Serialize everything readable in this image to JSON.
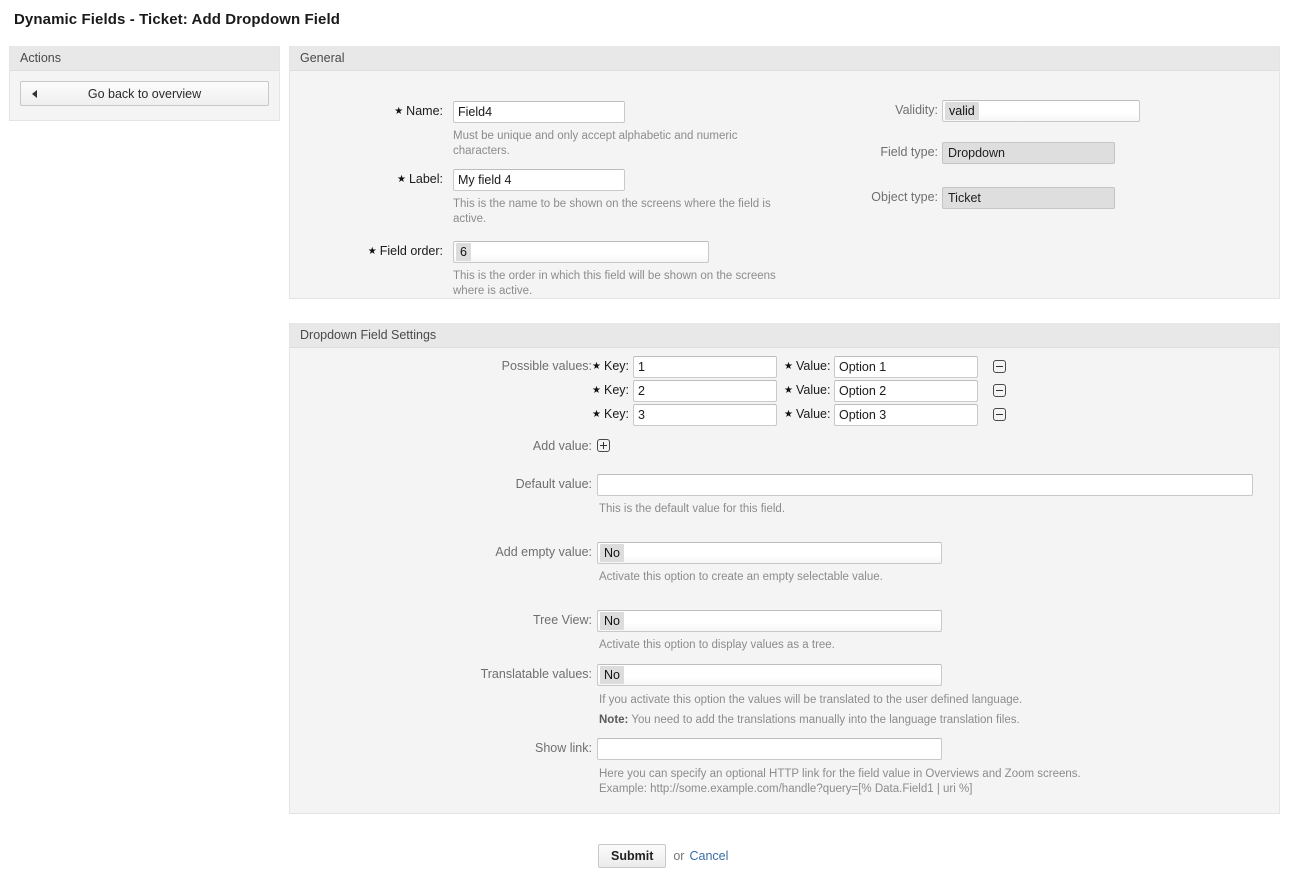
{
  "page": {
    "title": "Dynamic Fields - Ticket: Add Dropdown Field"
  },
  "sidebar": {
    "header": "Actions",
    "back_button": {
      "label": "Go back to overview",
      "icon": "left-arrow-icon"
    }
  },
  "general": {
    "header": "General",
    "name": {
      "label": "Name:",
      "required": true,
      "value": "Field4",
      "hint": "Must be unique and only accept alphabetic and numeric characters."
    },
    "label_field": {
      "label": "Label:",
      "required": true,
      "value": "My field 4",
      "hint": "This is the name to be shown on the screens where the field is active."
    },
    "field_order": {
      "label": "Field order:",
      "required": true,
      "value": "6",
      "hint": "This is the order in which this field will be shown on the screens where is active."
    },
    "validity": {
      "label": "Validity:",
      "value": "valid"
    },
    "field_type": {
      "label": "Field type:",
      "value": "Dropdown"
    },
    "object_type": {
      "label": "Object type:",
      "value": "Ticket"
    }
  },
  "dropdown_settings": {
    "header": "Dropdown Field Settings",
    "possible_values": {
      "label": "Possible values:",
      "key_label": "Key:",
      "value_label": "Value:",
      "remove_icon": "remove-value-icon",
      "rows": [
        {
          "key": "1",
          "value": "Option 1"
        },
        {
          "key": "2",
          "value": "Option 2"
        },
        {
          "key": "3",
          "value": "Option 3"
        }
      ]
    },
    "add_value": {
      "label": "Add value:",
      "icon": "add-value-icon"
    },
    "default_value": {
      "label": "Default value:",
      "value": "",
      "hint": "This is the default value for this field."
    },
    "add_empty_value": {
      "label": "Add empty value:",
      "value": "No",
      "hint": "Activate this option to create an empty selectable value."
    },
    "tree_view": {
      "label": "Tree View:",
      "value": "No",
      "hint": "Activate this option to display values as a tree."
    },
    "translatable_values": {
      "label": "Translatable values:",
      "value": "No",
      "hint": "If you activate this option the values will be translated to the user defined language.",
      "note_prefix": "Note:",
      "note": " You need to add the translations manually into the language translation files."
    },
    "show_link": {
      "label": "Show link:",
      "value": "",
      "hint_line1": "Here you can specify an optional HTTP link for the field value in Overviews and Zoom screens.",
      "hint_line2": "Example: http://some.example.com/handle?query=[% Data.Field1 | uri %]"
    }
  },
  "footer": {
    "submit_label": "Submit",
    "or_text": "or",
    "cancel_label": "Cancel"
  }
}
